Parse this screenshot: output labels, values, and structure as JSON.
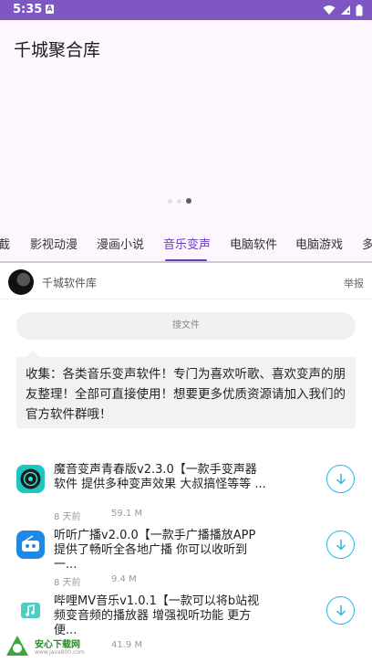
{
  "status_bar": {
    "time": "5:35",
    "notification_icon": "A"
  },
  "app": {
    "title": "千城聚合库"
  },
  "carousel": {
    "dots": 3,
    "active_dot": 3
  },
  "tabs": [
    {
      "label": "截"
    },
    {
      "label": "影视动漫"
    },
    {
      "label": "漫画小说"
    },
    {
      "label": "音乐变声",
      "active": true
    },
    {
      "label": "电脑软件"
    },
    {
      "label": "电脑游戏"
    },
    {
      "label": "多"
    }
  ],
  "author": {
    "name": "千城软件库",
    "report_label": "举报"
  },
  "search": {
    "placeholder": "搜文件"
  },
  "description": "收集：各类音乐变声软件！专门为喜欢听歌、喜欢变声的朋友整理！全部可直接使用！想要更多优质资源请加入我们的官方软件群哦！",
  "files": [
    {
      "title": "魔音变声青春版v2.3.0【一款手变声器软件 提供多种变声效果 大叔搞怪等等 ...",
      "date": "8 天前",
      "size": "59.1 M",
      "icon": "vinyl-record-icon"
    },
    {
      "title": "听听广播v2.0.0【一款手广播播放APP 提供了畅听全各地广播 你可以收听到一...",
      "date": "8 天前",
      "size": "9.4 M",
      "icon": "radio-icon"
    },
    {
      "title": "哔哩MV音乐v1.0.1【一款可以将b站视频变音频的播放器 增强视听功能 更方便...",
      "date": "",
      "size": "41.9 M",
      "icon": "music-video-icon"
    }
  ],
  "watermark": {
    "text": "安心下载网",
    "url": "www.java800.com"
  },
  "colors": {
    "status_bar": "#7e57c2",
    "accent": "#6a3fb5",
    "download": "#2ab6e6",
    "hero_bg": "#fdf6ff"
  }
}
